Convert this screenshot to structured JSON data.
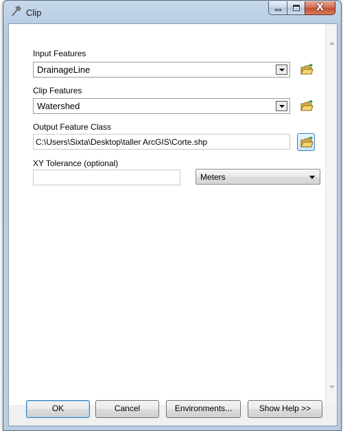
{
  "window": {
    "title": "Clip",
    "app_icon": "hammer-icon",
    "caption_buttons": [
      "minimize-icon",
      "maximize-icon",
      "close-icon"
    ],
    "close_glyph": "X"
  },
  "form": {
    "input_features": {
      "label": "Input Features",
      "value": "DrainageLine"
    },
    "clip_features": {
      "label": "Clip Features",
      "value": "Watershed"
    },
    "output_feature_class": {
      "label": "Output Feature Class",
      "value": "C:\\Users\\Sixta\\Desktop\\taller ArcGIS\\Corte.shp"
    },
    "xy_tolerance": {
      "label": "XY Tolerance (optional)",
      "value": "",
      "units": "Meters"
    },
    "browse_icon": "open-folder-icon"
  },
  "buttons": {
    "ok": "OK",
    "cancel": "Cancel",
    "environments": "Environments...",
    "show_help": "Show Help >>"
  },
  "colors": {
    "frame": "#b9cde3",
    "close_button": "#c14f33",
    "focus_border": "#3c7fb1"
  }
}
